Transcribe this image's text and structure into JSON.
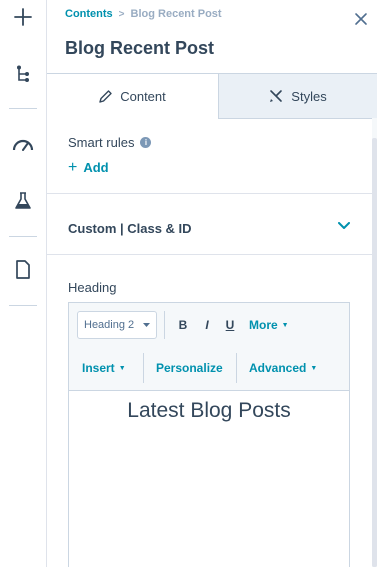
{
  "rail": {
    "icons": [
      "plus-icon",
      "tree-icon",
      "gauge-icon",
      "flask-icon",
      "document-icon"
    ]
  },
  "breadcrumb": {
    "parent": "Contents",
    "separator": ">",
    "current": "Blog Recent Post"
  },
  "panel": {
    "title": "Blog Recent Post"
  },
  "tabs": {
    "content": "Content",
    "styles": "Styles"
  },
  "smart_rules": {
    "label": "Smart rules",
    "info": "i",
    "add_plus": "+",
    "add_label": "Add"
  },
  "accordion": {
    "label": "Custom | Class & ID"
  },
  "heading_field": {
    "label": "Heading",
    "format_value": "Heading 2",
    "bold": "B",
    "italic": "I",
    "underline": "U",
    "more": "More",
    "insert": "Insert",
    "personalize": "Personalize",
    "advanced": "Advanced",
    "caret": "▼",
    "value": "Latest Blog Posts"
  },
  "colors": {
    "accent": "#0091ae",
    "text": "#33475b",
    "border": "#cbd6e2",
    "tab_inactive_bg": "#eaf0f6"
  }
}
